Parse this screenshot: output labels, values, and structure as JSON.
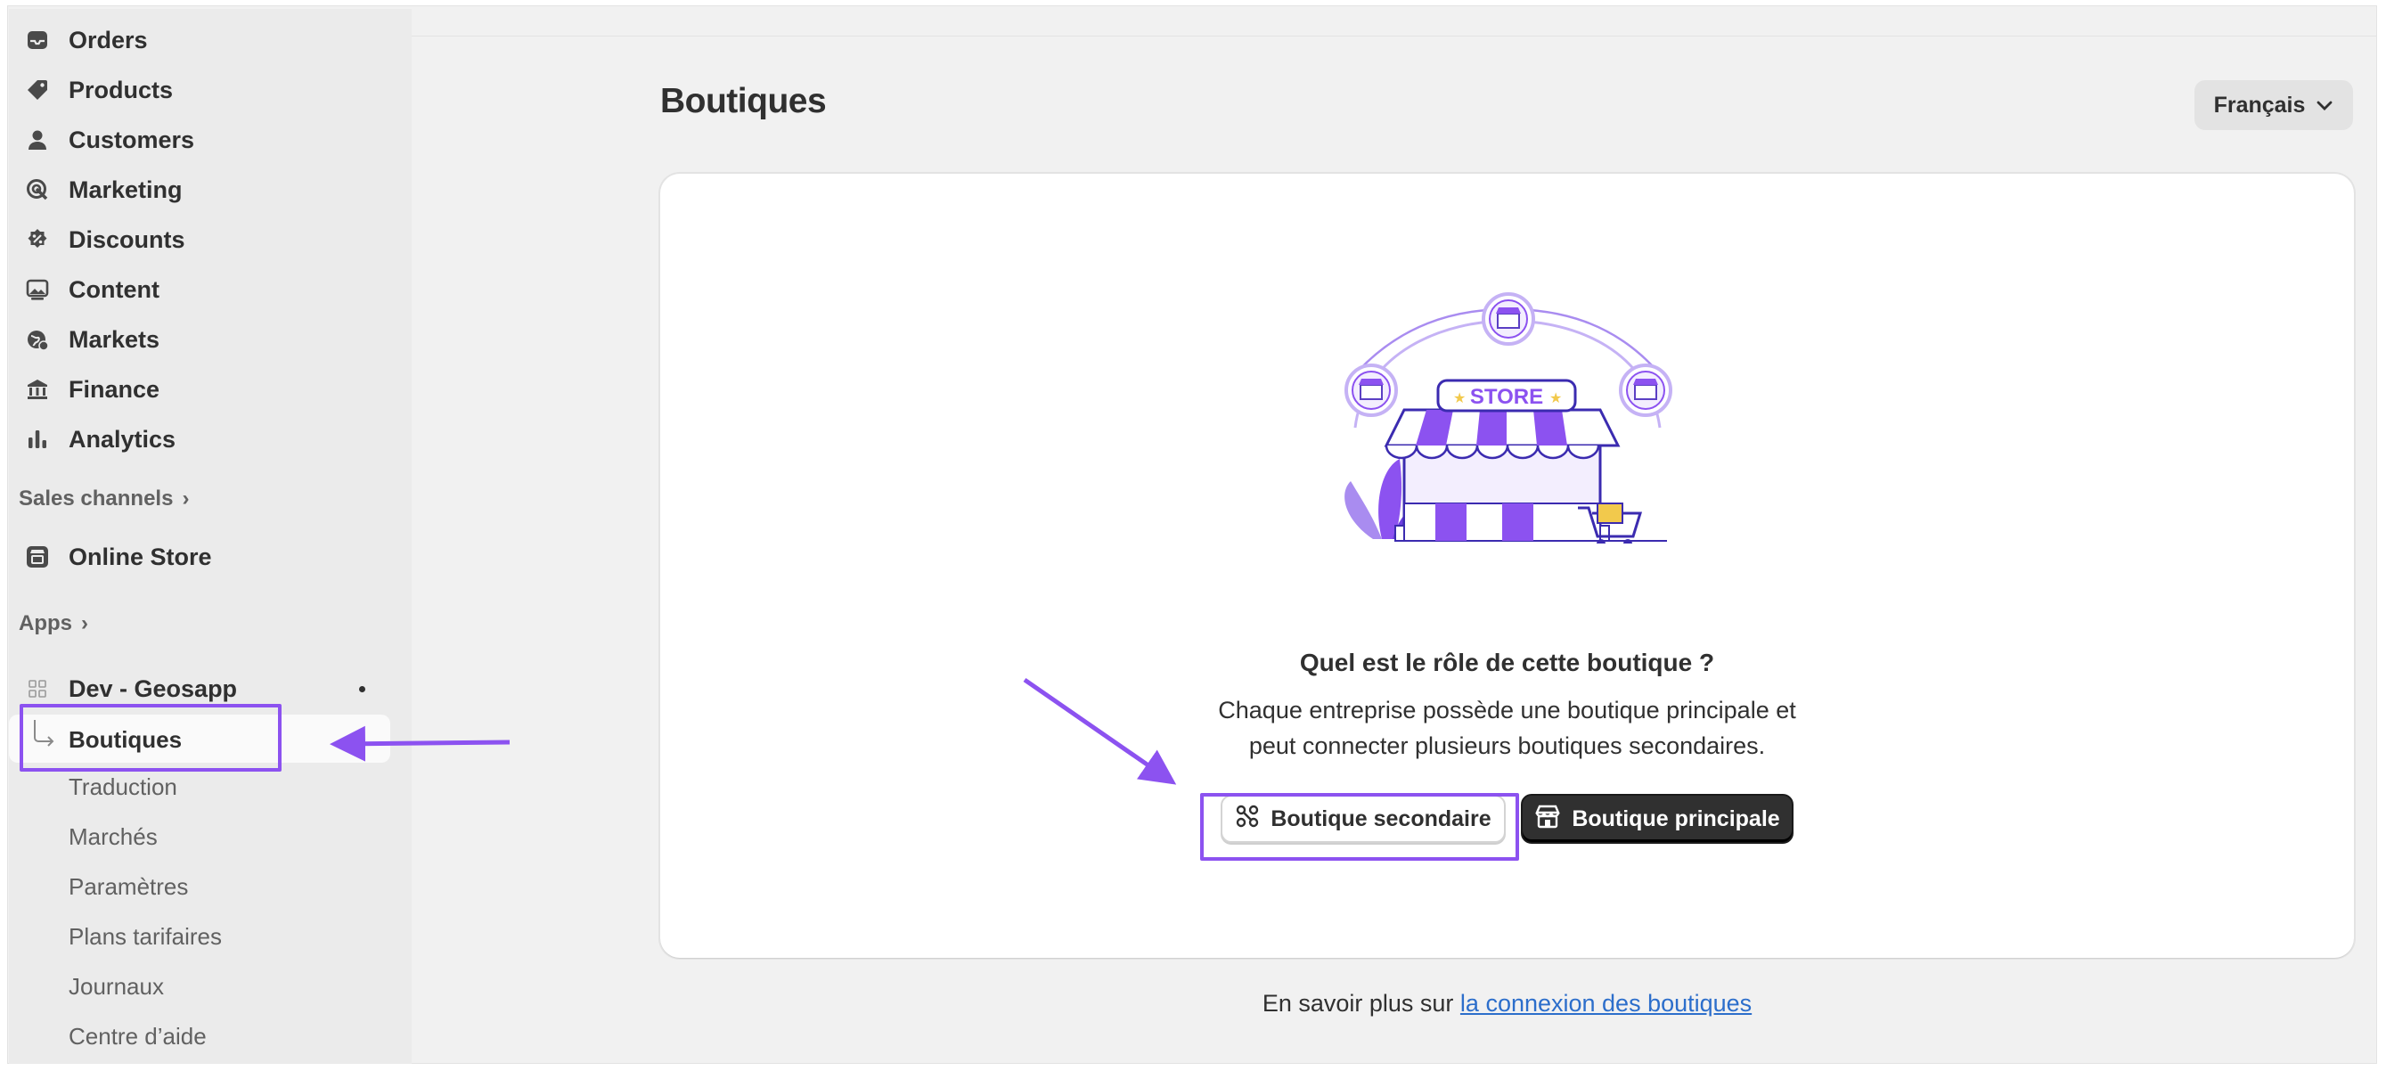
{
  "sidebar": {
    "items": [
      {
        "label": "Orders",
        "icon": "inbox-icon"
      },
      {
        "label": "Products",
        "icon": "tag-icon"
      },
      {
        "label": "Customers",
        "icon": "person-icon"
      },
      {
        "label": "Marketing",
        "icon": "target-icon"
      },
      {
        "label": "Discounts",
        "icon": "discount-icon"
      },
      {
        "label": "Content",
        "icon": "image-icon"
      },
      {
        "label": "Markets",
        "icon": "globe-icon"
      },
      {
        "label": "Finance",
        "icon": "bank-icon"
      },
      {
        "label": "Analytics",
        "icon": "bar-chart-icon"
      }
    ],
    "sales_channels_label": "Sales channels",
    "online_store_label": "Online Store",
    "apps_label": "Apps",
    "app_name": "Dev - Geosapp",
    "app_subitems": [
      {
        "label": "Boutiques",
        "active": true
      },
      {
        "label": "Traduction"
      },
      {
        "label": "Marchés"
      },
      {
        "label": "Paramètres"
      },
      {
        "label": "Plans tarifaires"
      },
      {
        "label": "Journaux"
      },
      {
        "label": "Centre d’aide"
      }
    ]
  },
  "header": {
    "title": "Boutiques",
    "language": "Français"
  },
  "card": {
    "illustration_sign": "STORE",
    "question": "Quel est le rôle de cette boutique ?",
    "description_line1": "Chaque entreprise possède une boutique principale et",
    "description_line2": "peut connecter plusieurs boutiques secondaires.",
    "secondary_button": "Boutique secondaire",
    "primary_button": "Boutique principale"
  },
  "footer": {
    "text": "En savoir plus sur ",
    "link": "la connexion des boutiques"
  },
  "colors": {
    "accent": "#8c52f0",
    "sidebar_bg": "#ebebeb",
    "page_bg": "#f1f1f1",
    "primary_button": "#303030",
    "link": "#2c6ecb"
  }
}
